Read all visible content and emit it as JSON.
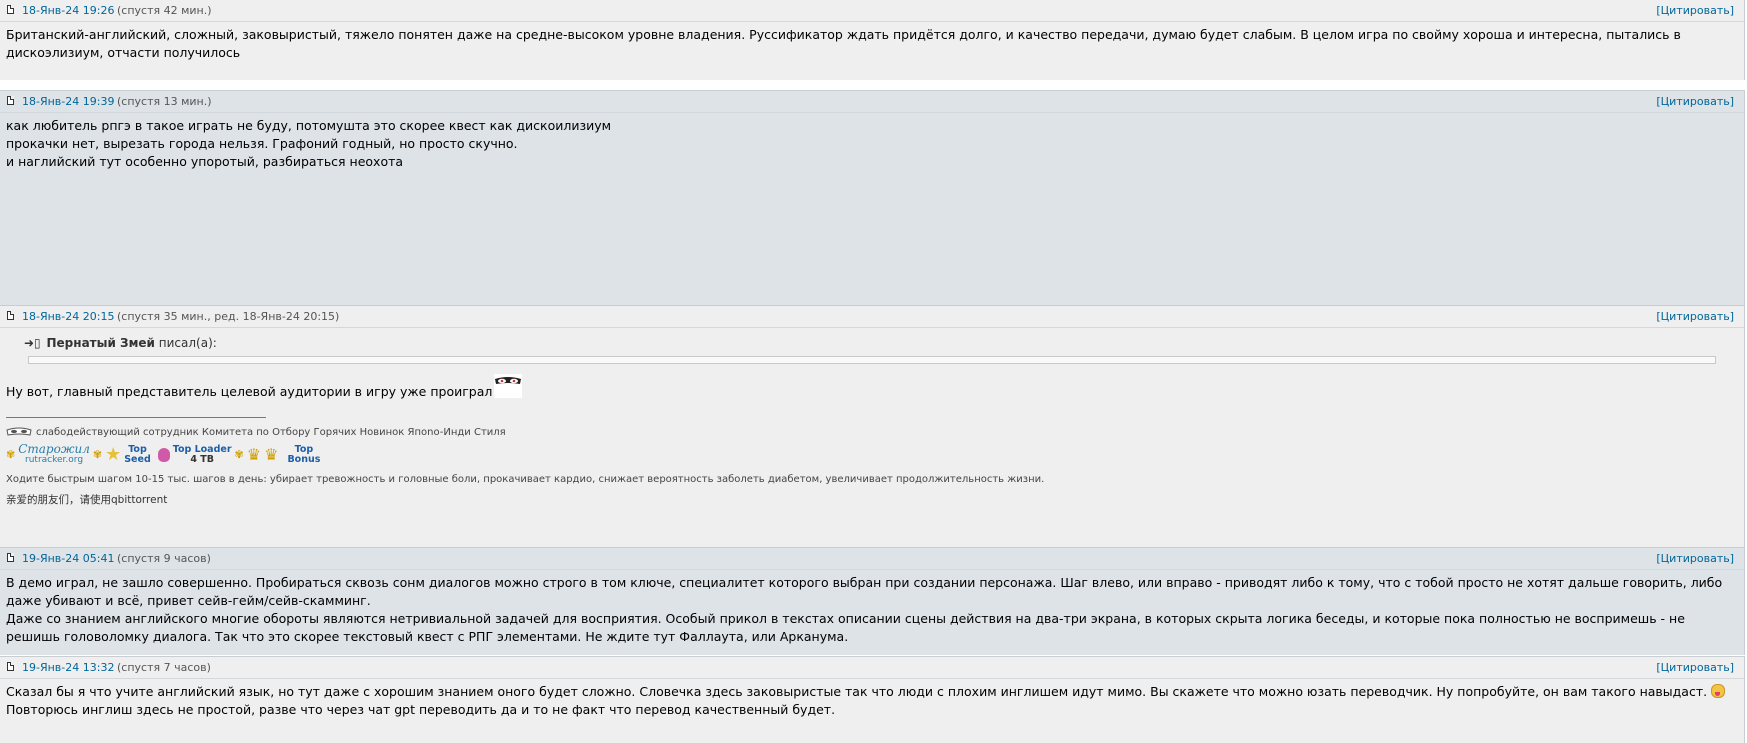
{
  "quote_label": "[Цитировать]",
  "posts": [
    {
      "date": "18-Янв-24 19:26",
      "after": "(спустя 42 мин.)",
      "text": "Британский-английский, сложный, заковыристый, тяжело понятен даже на средне-высоком уровне владения. Руссификатор ждать придётся долго, и качество передачи, думаю будет слабым. В целом игра по свойму хороша и интересна, пытались в дискоэлизиум, отчасти получилось"
    },
    {
      "date": "18-Янв-24 19:39",
      "after": "(спустя 13 мин.)",
      "lines": [
        "как любитель рпгэ в такое играть не буду, потомушта это скорее квест как дискоилизиум",
        "прокачки нет, вырезать города нельзя. Графоний годный, но просто скучно.",
        "и наглийский тут особенно упоротый, разбираться неохота"
      ]
    },
    {
      "date": "18-Янв-24 20:15",
      "after": "(спустя 35 мин., ред. 18-Янв-24 20:15)",
      "quote_author": "Пернатый Змей",
      "quote_wrote": "писал(а):",
      "text": "Ну вот, главный представитель целевой аудитории в игру уже проиграл",
      "signature": {
        "title": "слабодействующий сотрудник Комитета по Отбору Горячих Новинок Япono-Инди Стиля",
        "badge_old": "Старожил",
        "badge_old_site": "rutracker.org",
        "badge_seed_1": "Top",
        "badge_seed_2": "Seed",
        "badge_loader_1": "Top Loader",
        "badge_loader_2": "4 TB",
        "badge_bonus_1": "Top",
        "badge_bonus_2": "Bonus",
        "advice": "Ходите быстрым шагом 10-15 тыс. шагов в день: убирает тревожность и головные боли, прокачивает кардио, снижает вероятность заболеть диабетом, увеличивает продолжительность жизни.",
        "chinese": "亲爱的朋友们，请使用qbittorrent"
      }
    },
    {
      "date": "19-Янв-24 05:41",
      "after": "(спустя 9 часов)",
      "lines": [
        "В демо играл, не зашло совершенно. Пробираться сквозь сонм диалогов можно строго в том ключе, специалитет которого выбран при создании персонажа. Шаг влево, или вправо - приводят либо к тому, что с тобой просто не хотят дальше говорить, либо даже убивают и всё, привет сейв-гейм/сейв-скамминг.",
        "Даже со знанием английского многие обороты являются нетривиальной задачей для восприятия. Особый прикол в текстах описании сцены действия на два-три экрана, в которых скрыта логика беседы, и которые пока полностью не воспримешь - не решишь головоломку диалога. Так что это скорее текстовый квест с РПГ элементами. Не ждите тут Фаллаута, или Арканума."
      ]
    },
    {
      "date": "19-Янв-24 13:32",
      "after": "(спустя 7 часов)",
      "text_a": "Сказал бы я что учите английский язык, но тут даже с хорошим знанием оного будет сложно. Словечка здесь заковыристые так что люди с плохим инглишем идут мимо. Вы скажете что можно юзать переводчик. Ну попробуйте, он вам такого навыдаст.",
      "text_b": "Повторюсь инглиш здесь не простой, разве что через чат gpt переводить да и то не факт что перевод качественный будет."
    }
  ]
}
